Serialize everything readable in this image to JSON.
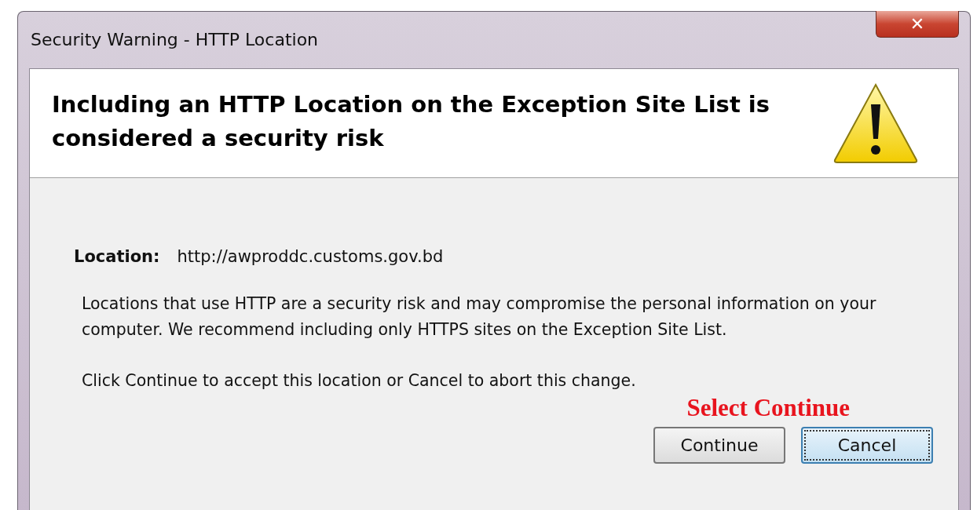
{
  "window": {
    "title": "Security Warning - HTTP Location",
    "close": "✕"
  },
  "header": {
    "heading": "Including an HTTP Location on the Exception Site List is considered a security risk"
  },
  "location": {
    "label": "Location:",
    "value": "http://awproddc.customs.gov.bd"
  },
  "message": [
    "Locations that use HTTP are a security risk and may compromise the personal information on your computer.  We recommend including only HTTPS sites on the Exception Site List.",
    "Click Continue to accept this location or Cancel to abort this change."
  ],
  "annotation": "Select Continue",
  "buttons": [
    {
      "label": "Continue",
      "focused": false
    },
    {
      "label": "Cancel",
      "focused": true
    }
  ]
}
